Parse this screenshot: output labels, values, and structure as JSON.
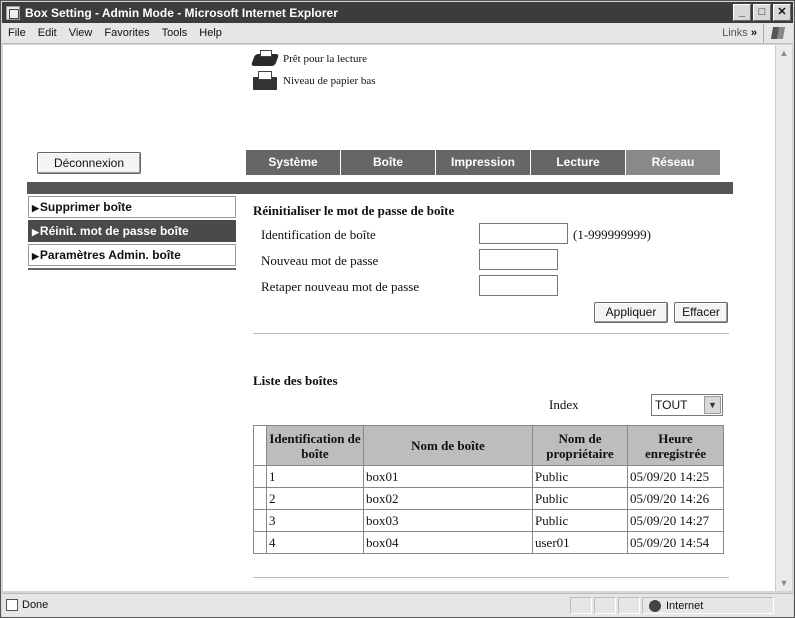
{
  "window": {
    "title": "Box Setting - Admin Mode - Microsoft Internet Explorer",
    "buttons": {
      "minimize": "_",
      "maximize": "□",
      "close": "✕"
    }
  },
  "menubar": {
    "items": [
      "File",
      "Edit",
      "View",
      "Favorites",
      "Tools",
      "Help"
    ],
    "links_label": "Links",
    "links_more": "»"
  },
  "printer_status": {
    "ready": "Prêt pour la lecture",
    "low_paper": "Niveau de papier bas"
  },
  "logout_label": "Déconnexion",
  "tabs": [
    {
      "label": "Système",
      "state": "dim"
    },
    {
      "label": "Boîte",
      "state": "dim"
    },
    {
      "label": "Impression",
      "state": "dim"
    },
    {
      "label": "Lecture",
      "state": "dim"
    },
    {
      "label": "Réseau",
      "state": "active"
    }
  ],
  "sidebar": {
    "items": [
      {
        "label": "Supprimer boîte",
        "active": false
      },
      {
        "label": "Réinit. mot de passe boîte",
        "active": true
      },
      {
        "label": "Paramètres Admin. boîte",
        "active": false
      }
    ]
  },
  "reset_form": {
    "title": "Réinitialiser le mot de passe de boîte",
    "box_id_label": "Identification de boîte",
    "box_id_value": "",
    "box_id_hint": "(1-999999999)",
    "new_password_label": "Nouveau mot de passe",
    "new_password_value": "",
    "retype_password_label": "Retaper nouveau mot de passe",
    "retype_password_value": "",
    "apply_label": "Appliquer",
    "clear_label": "Effacer"
  },
  "box_list": {
    "title": "Liste des boîtes",
    "index_label": "Index",
    "index_value": "TOUT",
    "columns": [
      "Identification de boîte",
      "Nom de boîte",
      "Nom de propriétaire",
      "Heure enregistrée"
    ],
    "rows": [
      {
        "id": "1",
        "name": "box01",
        "owner": "Public",
        "time": "05/09/20 14:25"
      },
      {
        "id": "2",
        "name": "box02",
        "owner": "Public",
        "time": "05/09/20 14:26"
      },
      {
        "id": "3",
        "name": "box03",
        "owner": "Public",
        "time": "05/09/20 14:27"
      },
      {
        "id": "4",
        "name": "box04",
        "owner": "user01",
        "time": "05/09/20 14:54"
      }
    ]
  },
  "statusbar": {
    "text": "Done",
    "zone": "Internet"
  },
  "icons": {
    "printer_ready": "printer-ready-icon",
    "printer_low_paper": "printer-low-paper-icon",
    "zone": "globe-icon"
  }
}
